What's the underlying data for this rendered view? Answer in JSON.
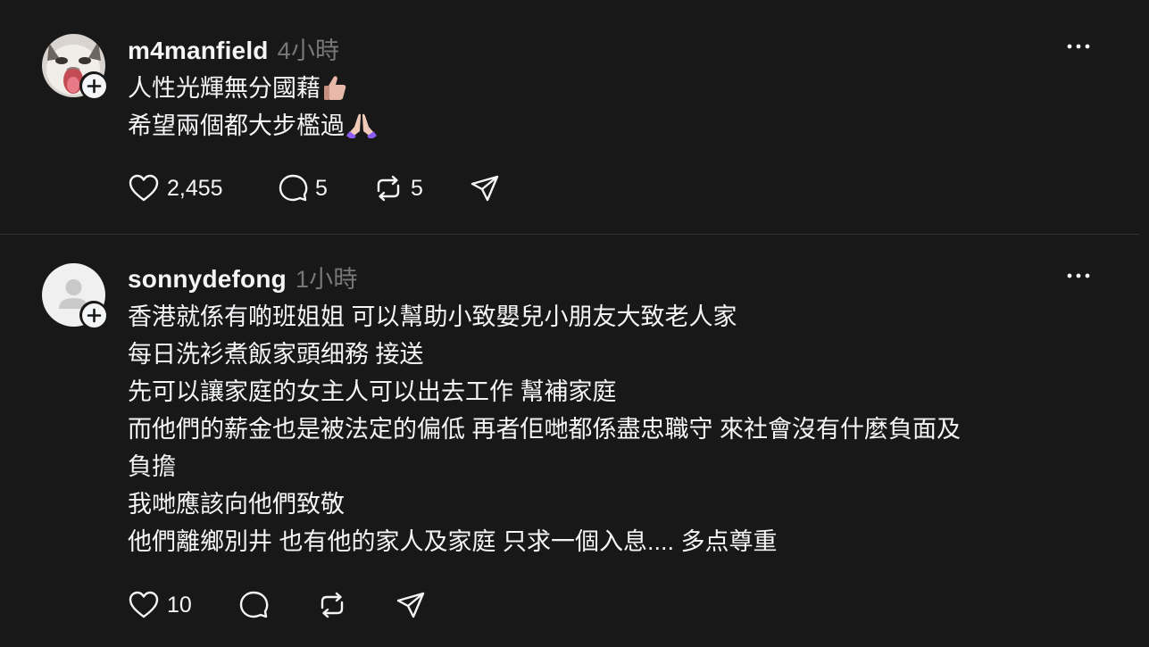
{
  "posts": [
    {
      "username": "m4manfield",
      "time": "4小時",
      "lines": [
        "人性光輝無分國藉",
        "希望兩個都大步檻過"
      ],
      "emojis": [
        "thumbs-up",
        "folded-hands"
      ],
      "likes": "2,455",
      "replies": "5",
      "reposts": "5"
    },
    {
      "username": "sonnydefong",
      "time": "1小時",
      "lines": [
        "香港就係有啲班姐姐 可以幫助小致嬰兒小朋友大致老人家",
        "每日洗衫煮飯家頭细務 接送",
        "先可以讓家庭的女主人可以出去工作 幫補家庭",
        "而他們的薪金也是被法定的偏低 再者佢哋都係盡忠職守 來社會沒有什麼負面及",
        "負擔",
        "我哋應該向他們致敬",
        "他們離鄉別井 也有他的家人及家庭 只求一個入息.... 多点尊重"
      ],
      "likes": "10",
      "replies": "",
      "reposts": ""
    }
  ],
  "colors": {
    "background": "#181818",
    "text": "#f3f5f7",
    "muted": "#777777",
    "divider": "#323232"
  },
  "icons": [
    "heart-icon",
    "comment-icon",
    "repost-icon",
    "share-icon",
    "more-icon",
    "plus-icon"
  ]
}
